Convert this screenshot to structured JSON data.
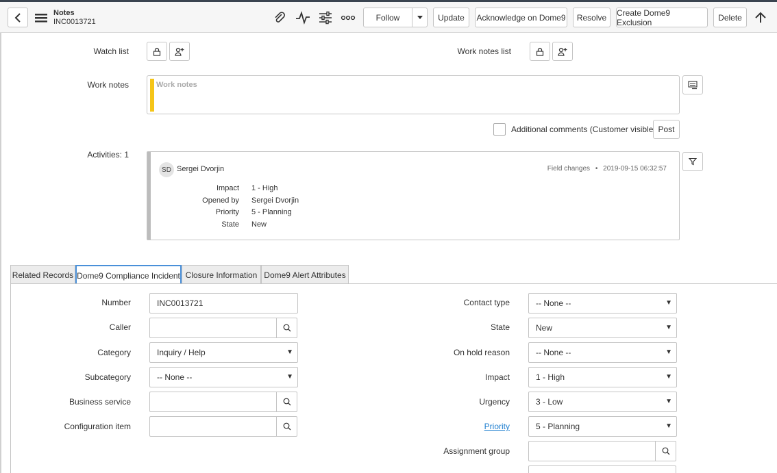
{
  "header": {
    "title": "Notes",
    "subtitle": "INC0013721",
    "buttons": {
      "follow": "Follow",
      "update": "Update",
      "acknowledge": "Acknowledge on Dome9",
      "resolve": "Resolve",
      "exclusion": "Create Dome9 Exclusion",
      "delete": "Delete"
    }
  },
  "notes": {
    "watch_list_label": "Watch list",
    "work_notes_list_label": "Work notes list",
    "work_notes_label": "Work notes",
    "work_notes_placeholder": "Work notes",
    "additional_comments_label": "Additional comments (Customer visible)",
    "post_label": "Post",
    "activities_label": "Activities: 1"
  },
  "activity": {
    "avatar_initials": "SD",
    "user": "Sergei Dvorjin",
    "type": "Field changes",
    "separator": "•",
    "timestamp": "2019-09-15 06:32:57",
    "changes": [
      {
        "label": "Impact",
        "value": "1 - High"
      },
      {
        "label": "Opened by",
        "value": "Sergei Dvorjin"
      },
      {
        "label": "Priority",
        "value": "5 - Planning"
      },
      {
        "label": "State",
        "value": "New"
      }
    ]
  },
  "tabs": [
    {
      "label": "Related Records"
    },
    {
      "label": "Dome9 Compliance Incident"
    },
    {
      "label": "Closure Information"
    },
    {
      "label": "Dome9 Alert Attributes"
    }
  ],
  "form": {
    "number": {
      "label": "Number",
      "value": "INC0013721"
    },
    "caller": {
      "label": "Caller",
      "value": ""
    },
    "category": {
      "label": "Category",
      "value": "Inquiry / Help"
    },
    "subcategory": {
      "label": "Subcategory",
      "value": "-- None --"
    },
    "business_service": {
      "label": "Business service",
      "value": ""
    },
    "configuration_item": {
      "label": "Configuration item",
      "value": ""
    },
    "contact_type": {
      "label": "Contact type",
      "value": "-- None --"
    },
    "state": {
      "label": "State",
      "value": "New"
    },
    "on_hold_reason": {
      "label": "On hold reason",
      "value": "-- None --"
    },
    "impact": {
      "label": "Impact",
      "value": "1 - High"
    },
    "urgency": {
      "label": "Urgency",
      "value": "3 - Low"
    },
    "priority": {
      "label": "Priority",
      "value": "5 - Planning"
    },
    "assignment_group": {
      "label": "Assignment group",
      "value": ""
    }
  },
  "colors": {
    "accent": "#4a90d9",
    "work_notes_bar": "#f5c518",
    "link": "#1f7fd0"
  }
}
